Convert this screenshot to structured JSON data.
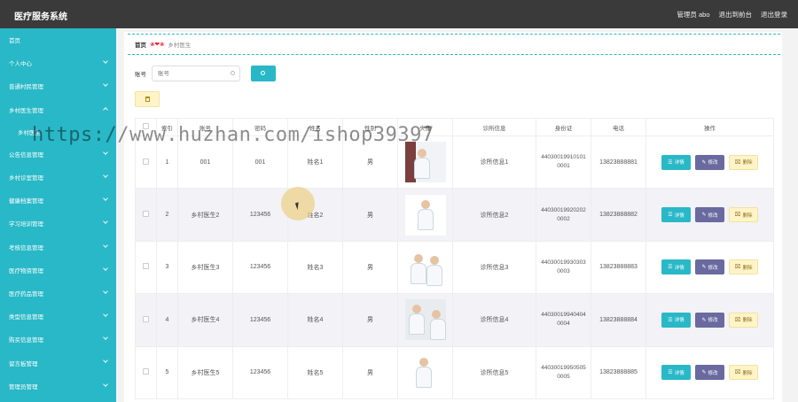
{
  "app": {
    "title": "医疗服务系统",
    "admin_label": "管理员 abo",
    "back_to_front": "退出到前台",
    "logout": "退出登录"
  },
  "sidebar": {
    "items": [
      {
        "label": "首页",
        "expandable": false
      },
      {
        "label": "个人中心",
        "expandable": true
      },
      {
        "label": "普通村民管理",
        "expandable": true
      },
      {
        "label": "乡村医生管理",
        "expandable": true,
        "expanded": true
      },
      {
        "label": "乡村医生",
        "expandable": false,
        "sub": true
      },
      {
        "label": "公告信息管理",
        "expandable": true
      },
      {
        "label": "乡村诊室管理",
        "expandable": true
      },
      {
        "label": "健康档案管理",
        "expandable": true
      },
      {
        "label": "学习培训管理",
        "expandable": true
      },
      {
        "label": "考核信息管理",
        "expandable": true
      },
      {
        "label": "医疗物资管理",
        "expandable": true
      },
      {
        "label": "医疗药品管理",
        "expandable": true
      },
      {
        "label": "类型信息管理",
        "expandable": true
      },
      {
        "label": "购买信息管理",
        "expandable": true
      },
      {
        "label": "留言板管理",
        "expandable": true
      },
      {
        "label": "管理员管理",
        "expandable": true
      }
    ]
  },
  "breadcrumb": {
    "home": "首页",
    "separator": "❀❤❀",
    "current": "乡村医生"
  },
  "search": {
    "label": "账号",
    "placeholder": "账号"
  },
  "table": {
    "headers": [
      "",
      "索引",
      "账号",
      "密码",
      "姓名",
      "性别",
      "头像",
      "诊所信息",
      "身份证",
      "电话",
      "操作"
    ],
    "rows": [
      {
        "index": "1",
        "account": "001",
        "password": "001",
        "name": "姓名1",
        "gender": "男",
        "clinic": "诊所信息1",
        "idcard": "440300199101010001",
        "phone": "13823888881"
      },
      {
        "index": "2",
        "account": "乡村医生2",
        "password": "123456",
        "name": "姓名2",
        "gender": "男",
        "clinic": "诊所信息2",
        "idcard": "440300199202020002",
        "phone": "13823888882"
      },
      {
        "index": "3",
        "account": "乡村医生3",
        "password": "123456",
        "name": "姓名3",
        "gender": "男",
        "clinic": "诊所信息3",
        "idcard": "440300199303030003",
        "phone": "13823888883"
      },
      {
        "index": "4",
        "account": "乡村医生4",
        "password": "123456",
        "name": "姓名4",
        "gender": "男",
        "clinic": "诊所信息4",
        "idcard": "440300199404040004",
        "phone": "13823888884"
      },
      {
        "index": "5",
        "account": "乡村医生5",
        "password": "123456",
        "name": "姓名5",
        "gender": "男",
        "clinic": "诊所信息5",
        "idcard": "440300199505050005",
        "phone": "13823888885"
      }
    ],
    "ops": {
      "detail": "详情",
      "edit": "修改",
      "delete": "删除"
    }
  },
  "watermark": "https://www.huzhan.com/ishop39397",
  "colors": {
    "accent": "#29b8c7",
    "edit": "#6a6aa0",
    "delete_bg": "#fff4c8",
    "topbar": "#3a3a3a"
  }
}
